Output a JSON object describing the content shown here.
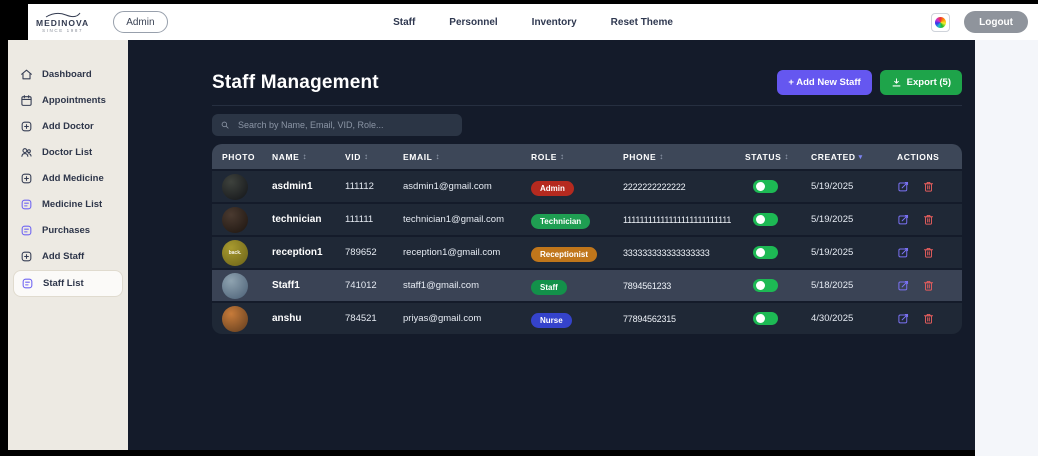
{
  "navbar": {
    "logo_title": "MEDINOVA",
    "logo_tagline": "SINCE 1987",
    "admin_badge": "Admin",
    "links": [
      {
        "label": "Staff"
      },
      {
        "label": "Personnel"
      },
      {
        "label": "Inventory"
      },
      {
        "label": "Reset Theme"
      }
    ],
    "logout_label": "Logout"
  },
  "sidebar": {
    "items": [
      {
        "label": "Dashboard",
        "icon": "home-icon",
        "accent": false,
        "active": false
      },
      {
        "label": "Appointments",
        "icon": "calendar-icon",
        "accent": false,
        "active": false
      },
      {
        "label": "Add Doctor",
        "icon": "plus-square-icon",
        "accent": false,
        "active": false
      },
      {
        "label": "Doctor List",
        "icon": "users-icon",
        "accent": false,
        "active": false
      },
      {
        "label": "Add Medicine",
        "icon": "plus-square-icon",
        "accent": false,
        "active": false
      },
      {
        "label": "Medicine List",
        "icon": "list-square-icon",
        "accent": true,
        "active": false
      },
      {
        "label": "Purchases",
        "icon": "list-square-icon",
        "accent": true,
        "active": false
      },
      {
        "label": "Add Staff",
        "icon": "plus-square-icon",
        "accent": false,
        "active": false
      },
      {
        "label": "Staff List",
        "icon": "list-square-icon",
        "accent": true,
        "active": true
      }
    ]
  },
  "main": {
    "title": "Staff Management",
    "add_button": "+ Add New Staff",
    "export_button": "Export (5)",
    "search_placeholder": "Search by Name, Email, VID, Role..."
  },
  "table": {
    "columns": [
      {
        "label": "PHOTO",
        "key": "photo",
        "sort": "none"
      },
      {
        "label": "NAME",
        "key": "name",
        "sort": "both"
      },
      {
        "label": "VID",
        "key": "vid",
        "sort": "both"
      },
      {
        "label": "EMAIL",
        "key": "email",
        "sort": "both"
      },
      {
        "label": "ROLE",
        "key": "role",
        "sort": "both"
      },
      {
        "label": "PHONE",
        "key": "phone",
        "sort": "both"
      },
      {
        "label": "STATUS",
        "key": "status",
        "sort": "both"
      },
      {
        "label": "CREATED",
        "key": "created",
        "sort": "desc"
      },
      {
        "label": "ACTIONS",
        "key": "actions",
        "sort": "none"
      }
    ],
    "rows": [
      {
        "name": "asdmin1",
        "vid": "111112",
        "email": "asdmin1@gmail.com",
        "role": "Admin",
        "role_color": "#b52a1f",
        "phone": "2222222222222",
        "status": true,
        "created": "5/19/2025",
        "highlight": false,
        "avatar": {
          "c1": "#3e423d",
          "c2": "#121418",
          "text": ""
        }
      },
      {
        "name": "technician",
        "vid": "111111",
        "email": "technician1@gmail.com",
        "role": "Technician",
        "role_color": "#1f9e52",
        "phone": "11111111111111111111111111",
        "status": true,
        "created": "5/19/2025",
        "highlight": false,
        "avatar": {
          "c1": "#4a3a30",
          "c2": "#1c140f",
          "text": ""
        }
      },
      {
        "name": "reception1",
        "vid": "789652",
        "email": "reception1@gmail.com",
        "role": "Receptionist",
        "role_color": "#c0761b",
        "phone": "333333333333333333",
        "status": true,
        "created": "5/19/2025",
        "highlight": false,
        "avatar": {
          "c1": "#a89a2f",
          "c2": "#6b6218",
          "text": "back."
        }
      },
      {
        "name": "Staff1",
        "vid": "741012",
        "email": "staff1@gmail.com",
        "role": "Staff",
        "role_color": "#13914a",
        "phone": "7894561233",
        "status": true,
        "created": "5/18/2025",
        "highlight": true,
        "avatar": {
          "c1": "#8fa3b0",
          "c2": "#4a5f75",
          "text": ""
        }
      },
      {
        "name": "anshu",
        "vid": "784521",
        "email": "priyas@gmail.com",
        "role": "Nurse",
        "role_color": "#3543cb",
        "phone": "77894562315",
        "status": true,
        "created": "4/30/2025",
        "highlight": false,
        "avatar": {
          "c1": "#c77b3a",
          "c2": "#5e3b1e",
          "text": ""
        }
      }
    ]
  },
  "colors": {
    "accent_purple": "#6557f0",
    "accent_green": "#1ea44a",
    "toggle_on": "#1db954",
    "panel_bg": "#141b2a",
    "row_bg": "#1f2836",
    "header_bg": "#3d4758",
    "sidebar_bg": "#edeae3"
  }
}
